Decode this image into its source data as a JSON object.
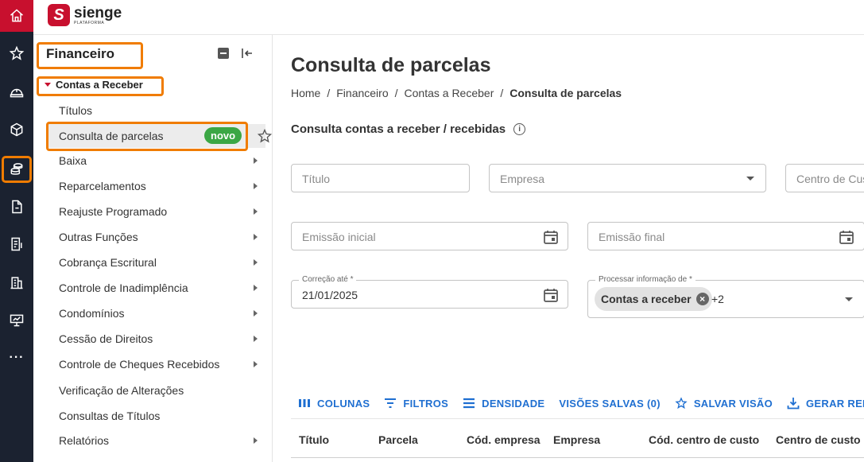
{
  "brand": {
    "name": "sienge",
    "subtitle": "PLATAFORMA",
    "mark": "S"
  },
  "rail": {
    "icons": [
      "home-icon",
      "star-icon",
      "helmet-icon",
      "cube-icon",
      "coins-icon",
      "document-icon",
      "invoice-icon",
      "building-icon",
      "presentation-icon",
      "more-icon"
    ],
    "more": "···"
  },
  "menu": {
    "title": "Financeiro",
    "group": "Contas a Receber",
    "items": [
      {
        "label": "Títulos",
        "arrow": false
      },
      {
        "label": "Consulta de parcelas",
        "arrow": false,
        "badge": "novo",
        "selected": true
      },
      {
        "label": "Baixa",
        "arrow": true
      },
      {
        "label": "Reparcelamentos",
        "arrow": true
      },
      {
        "label": "Reajuste Programado",
        "arrow": true
      },
      {
        "label": "Outras Funções",
        "arrow": true
      },
      {
        "label": "Cobrança Escritural",
        "arrow": true
      },
      {
        "label": "Controle de Inadimplência",
        "arrow": true
      },
      {
        "label": "Condomínios",
        "arrow": true
      },
      {
        "label": "Cessão de Direitos",
        "arrow": true
      },
      {
        "label": "Controle de Cheques Recebidos",
        "arrow": true
      },
      {
        "label": "Verificação de Alterações",
        "arrow": false
      },
      {
        "label": "Consultas de Títulos",
        "arrow": false
      },
      {
        "label": "Relatórios",
        "arrow": true
      }
    ]
  },
  "main": {
    "title": "Consulta de parcelas",
    "breadcrumb": [
      "Home",
      "/",
      "Financeiro",
      "/",
      "Contas a Receber",
      "/",
      "Consulta de parcelas"
    ],
    "section": "Consulta contas a receber / recebidas",
    "info_icon": "i",
    "fields": {
      "titulo": {
        "placeholder": "Título"
      },
      "empresa": {
        "placeholder": "Empresa"
      },
      "centro": {
        "placeholder": "Centro de Custo"
      },
      "emissao_inicial": {
        "placeholder": "Emissão inicial"
      },
      "emissao_final": {
        "placeholder": "Emissão final"
      },
      "correcao": {
        "label": "Correção até *",
        "value": "21/01/2025"
      },
      "processar": {
        "label": "Processar informação de *",
        "chip": "Contas a receber",
        "chip_remove": "×",
        "more": "+2"
      }
    },
    "toolbar": [
      "COLUNAS",
      "FILTROS",
      "DENSIDADE",
      "VISÕES SALVAS (0)",
      "SALVAR VISÃO",
      "GERAR RELATÓRIO"
    ],
    "columns": [
      "Título",
      "Parcela",
      "Cód. empresa",
      "Empresa",
      "Cód. centro de custo",
      "Centro de custo"
    ]
  },
  "colors": {
    "brand_red": "#c8102e",
    "highlight_orange": "#f07c00",
    "badge_green": "#3ba745",
    "link_blue": "#1f6fd1",
    "rail_bg": "#1b2230"
  }
}
